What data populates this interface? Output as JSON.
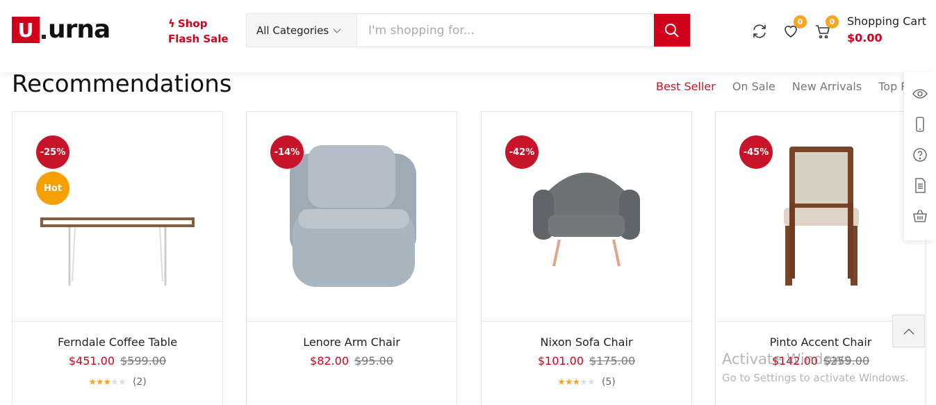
{
  "header": {
    "logo_letter": "U",
    "logo_text": "urna",
    "flash_line1": "Shop",
    "flash_line2": "Flash Sale",
    "category_label": "All Categories",
    "search_placeholder": "I'm shopping for...",
    "wishlist_count": "0",
    "cart_count": "0",
    "cart_label": "Shopping Cart",
    "cart_total": "$0.00"
  },
  "section": {
    "title": "Recommendations",
    "tabs": [
      "Best Seller",
      "On Sale",
      "New Arrivals",
      "Top Rated"
    ],
    "active_tab": "Best Seller"
  },
  "products": [
    {
      "name": "Ferndale Coffee Table",
      "price": "$451.00",
      "old_price": "$599.00",
      "discount": "-25%",
      "hot": "Hot",
      "rating": 3,
      "reviews": "(2)"
    },
    {
      "name": "Lenore Arm Chair",
      "price": "$82.00",
      "old_price": "$95.00",
      "discount": "-14%",
      "rating": 0,
      "reviews": ""
    },
    {
      "name": "Nixon Sofa Chair",
      "price": "$101.00",
      "old_price": "$175.00",
      "discount": "-42%",
      "rating": 3,
      "reviews": "(5)"
    },
    {
      "name": "Pinto Accent Chair",
      "price": "$142.00",
      "old_price": "$259.00",
      "discount": "-45%",
      "rating": 0,
      "reviews": ""
    }
  ],
  "watermark": {
    "line1": "Activate Windows",
    "line2": "Go to Settings to activate Windows."
  },
  "colors": {
    "accent": "#d0021b",
    "badge": "#f5a623",
    "hot": "#f5a000"
  }
}
